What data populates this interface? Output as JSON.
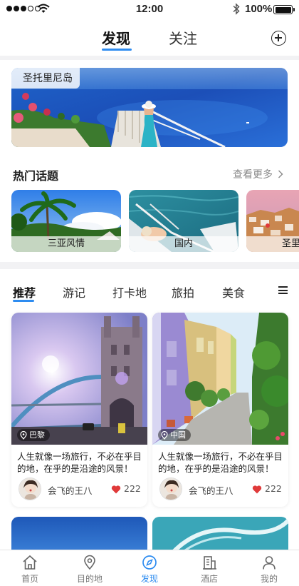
{
  "status_bar": {
    "time": "12:00",
    "battery": "100%"
  },
  "header": {
    "tabs": [
      {
        "label": "发现",
        "active": true
      },
      {
        "label": "关注",
        "active": false
      }
    ],
    "add_icon": "plus-circle-icon"
  },
  "banner": {
    "label": "圣托里尼岛"
  },
  "topics": {
    "title": "热门话题",
    "more": "查看更多",
    "items": [
      {
        "label": "三亚风情"
      },
      {
        "label": "国内"
      },
      {
        "label": "圣里"
      }
    ]
  },
  "categories": {
    "tabs": [
      {
        "label": "推荐",
        "active": true
      },
      {
        "label": "游记"
      },
      {
        "label": "打卡地"
      },
      {
        "label": "旅拍"
      },
      {
        "label": "美食"
      }
    ],
    "menu_icon": "hamburger-icon"
  },
  "posts": [
    {
      "location": "巴黎",
      "text": "人生就像一场旅行，不必在乎目的地，在乎的是沿途的风景！",
      "author": "会飞的王八",
      "likes": "222"
    },
    {
      "location": "中国",
      "text": "人生就像一场旅行，不必在乎目的地，在乎的是沿途的风景！",
      "author": "会飞的王八",
      "likes": "222"
    }
  ],
  "bottom_nav": [
    {
      "label": "首页",
      "icon": "home-icon"
    },
    {
      "label": "目的地",
      "icon": "location-pin-icon"
    },
    {
      "label": "发现",
      "icon": "compass-icon",
      "active": true
    },
    {
      "label": "酒店",
      "icon": "hotel-icon"
    },
    {
      "label": "我的",
      "icon": "user-icon"
    }
  ],
  "colors": {
    "accent": "#2e8cf0",
    "like": "#e03a3a"
  }
}
